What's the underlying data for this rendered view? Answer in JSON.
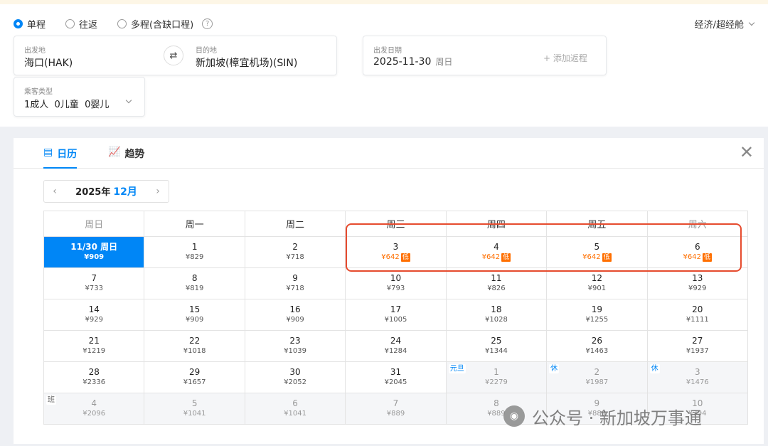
{
  "trip_types": [
    {
      "label": "单程",
      "checked": true
    },
    {
      "label": "往返",
      "checked": false
    },
    {
      "label": "多程(含缺口程)",
      "checked": false
    }
  ],
  "cabin": "经济/超经舱",
  "origin": {
    "label": "出发地",
    "value": "海口(HAK)"
  },
  "destination": {
    "label": "目的地",
    "value": "新加坡(樟宜机场)(SIN)"
  },
  "depart": {
    "label": "出发日期",
    "date": "2025-11-30",
    "weekday": "周日"
  },
  "add_return": "+ 添加返程",
  "passengers": {
    "label": "乘客类型",
    "value": "1成人  0儿童  0婴儿"
  },
  "tabs": {
    "calendar": "日历",
    "trend": "趋势"
  },
  "month_nav": {
    "year": "2025年",
    "month": "12月"
  },
  "weekdays": [
    "周日",
    "周一",
    "周二",
    "周三",
    "周四",
    "周五",
    "周六"
  ],
  "weeks": [
    [
      {
        "day": "11/30 周日",
        "price": "¥909"
      },
      {
        "day": "1",
        "price": "¥829"
      },
      {
        "day": "2",
        "price": "¥718"
      },
      {
        "day": "3",
        "price": "¥642",
        "low": "低"
      },
      {
        "day": "4",
        "price": "¥642",
        "low": "低"
      },
      {
        "day": "5",
        "price": "¥642",
        "low": "低"
      },
      {
        "day": "6",
        "price": "¥642",
        "low": "低"
      }
    ],
    [
      {
        "day": "7",
        "price": "¥733"
      },
      {
        "day": "8",
        "price": "¥819"
      },
      {
        "day": "9",
        "price": "¥718"
      },
      {
        "day": "10",
        "price": "¥793"
      },
      {
        "day": "11",
        "price": "¥826"
      },
      {
        "day": "12",
        "price": "¥901"
      },
      {
        "day": "13",
        "price": "¥929"
      }
    ],
    [
      {
        "day": "14",
        "price": "¥929"
      },
      {
        "day": "15",
        "price": "¥909"
      },
      {
        "day": "16",
        "price": "¥909"
      },
      {
        "day": "17",
        "price": "¥1005"
      },
      {
        "day": "18",
        "price": "¥1028"
      },
      {
        "day": "19",
        "price": "¥1255"
      },
      {
        "day": "20",
        "price": "¥1111"
      }
    ],
    [
      {
        "day": "21",
        "price": "¥1219"
      },
      {
        "day": "22",
        "price": "¥1018"
      },
      {
        "day": "23",
        "price": "¥1039"
      },
      {
        "day": "24",
        "price": "¥1284"
      },
      {
        "day": "25",
        "price": "¥1344"
      },
      {
        "day": "26",
        "price": "¥1463"
      },
      {
        "day": "27",
        "price": "¥1937"
      }
    ],
    [
      {
        "day": "28",
        "price": "¥2336"
      },
      {
        "day": "29",
        "price": "¥1657"
      },
      {
        "day": "30",
        "price": "¥2052"
      },
      {
        "day": "31",
        "price": "¥2045"
      },
      {
        "day": "1",
        "price": "¥2279",
        "tag": "元旦",
        "tag_type": "hol",
        "next": true
      },
      {
        "day": "2",
        "price": "¥1987",
        "tag": "休",
        "tag_type": "hol",
        "next": true
      },
      {
        "day": "3",
        "price": "¥1476",
        "tag": "休",
        "tag_type": "hol",
        "next": true
      }
    ],
    [
      {
        "day": "4",
        "price": "¥2096",
        "tag": "班",
        "tag_type": "work",
        "next": true
      },
      {
        "day": "5",
        "price": "¥1041",
        "next": true
      },
      {
        "day": "6",
        "price": "¥1041",
        "next": true
      },
      {
        "day": "7",
        "price": "¥889",
        "next": true
      },
      {
        "day": "8",
        "price": "¥889",
        "next": true
      },
      {
        "day": "9",
        "price": "¥889",
        "next": true
      },
      {
        "day": "10",
        "price": "¥794",
        "next": true
      }
    ]
  ],
  "watermark": "公众号 · 新加坡万事通"
}
